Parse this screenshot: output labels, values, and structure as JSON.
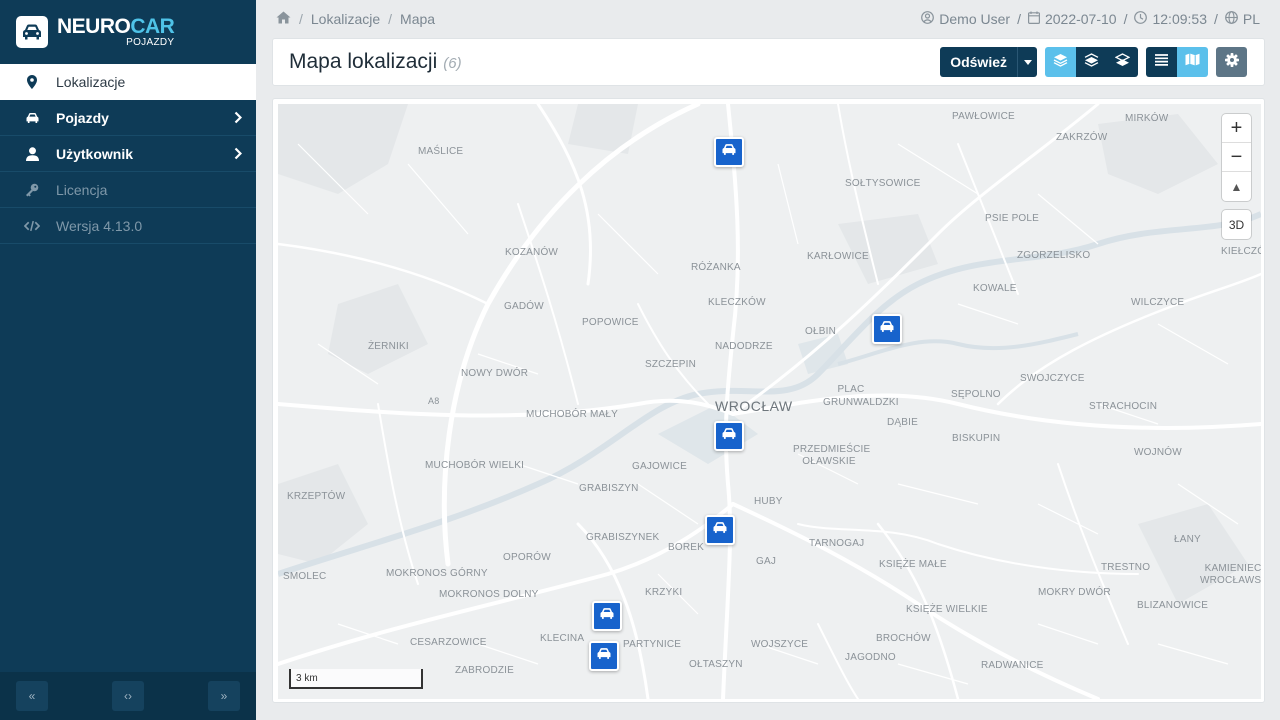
{
  "brand": {
    "name_a": "NEURO",
    "name_b": "CAR",
    "sub": "POJAZDY"
  },
  "sidebar": {
    "items": [
      {
        "label": "Lokalizacje",
        "icon": "map-marker-icon"
      },
      {
        "label": "Pojazdy",
        "icon": "car-icon"
      },
      {
        "label": "Użytkownik",
        "icon": "user-icon"
      },
      {
        "label": "Licencja",
        "icon": "key-icon"
      },
      {
        "label": "Wersja 4.13.0",
        "icon": "code-icon"
      }
    ],
    "footer": {
      "collapse": "«",
      "code": "‹›",
      "expand": "»"
    }
  },
  "breadcrumb": {
    "home_icon": "home-icon",
    "items": [
      "Lokalizacje",
      "Mapa"
    ],
    "separator": "/"
  },
  "header": {
    "user": "Demo User",
    "date": "2022-07-10",
    "time": "12:09:53",
    "lang": "PL",
    "separator": "/"
  },
  "page": {
    "title": "Mapa lokalizacji",
    "count": "(6)"
  },
  "toolbar": {
    "refresh_label": "Odśwież"
  },
  "map": {
    "zoom_in": "+",
    "zoom_out": "−",
    "compass": "▲",
    "btn_3d": "3D",
    "scale": "3 km",
    "city": "WROCŁAW",
    "places": [
      "PAWŁOWICE",
      "MIRKÓW",
      "MAŚLICE",
      "ZAKRZÓW",
      "SOŁTYSOWICE",
      "PSIE POLE",
      "KOZANÓW",
      "RÓŻANKA",
      "KARŁOWICE",
      "ZGORZELISKO",
      "KIEŁCZÓW",
      "KOWALE",
      "GADÓW",
      "KLECZKÓW",
      "WILCZYCE",
      "POPOWICE",
      "OŁBIN",
      "ŻERNIKI",
      "NADODRZE",
      "SZCZEPIN",
      "NOWY DWÓR",
      "PLAC GRUNWALDZKI",
      "SĘPOLNO",
      "SWOJCZYCE",
      "DĄBIE",
      "STRACHOCIN",
      "MUCHOBÓR MAŁY",
      "BISKUPIN",
      "PRZEDMIEŚCIE OŁAWSKIE",
      "WOJNÓW",
      "MUCHOBÓR WIELKI",
      "GAJOWICE",
      "KRZEPTÓW",
      "GRABISZYN",
      "HUBY",
      "GRABISZYNEK",
      "BOREK",
      "TARNOGAJ",
      "ŁANY",
      "OPORÓW",
      "GAJ",
      "SMOLEC",
      "KSIĘŻE MAŁE",
      "TRESTNO",
      "KAMIENIEC WROCŁAWSKI",
      "MOKRONOS GÓRNY",
      "MOKRONOS DOLNY",
      "KRZYKI",
      "MOKRY DWÓR",
      "BLIZANOWICE",
      "KSIĘŻE WIELKIE",
      "CESARZOWICE",
      "KLECINA",
      "PARTYNICE",
      "WOJSZYCE",
      "BROCHÓW",
      "ZABRODZIE",
      "OŁTASZYN",
      "JAGODNO",
      "RADWANICE",
      "A8"
    ]
  }
}
